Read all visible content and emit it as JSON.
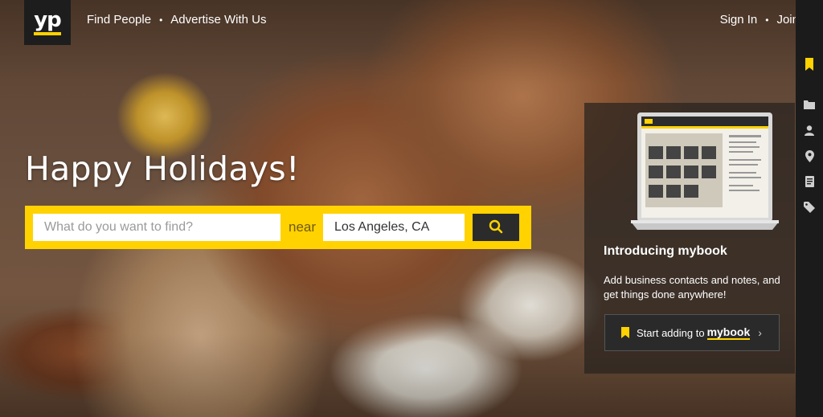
{
  "header": {
    "logo_text": "yp",
    "nav_left": [
      "Find People",
      "Advertise With Us"
    ],
    "nav_right": [
      "Sign In",
      "Join"
    ]
  },
  "hero": {
    "headline": "Happy Holidays!"
  },
  "search": {
    "what_placeholder": "What do you want to find?",
    "near_label": "near",
    "location_value": "Los Angeles, CA",
    "button_icon": "search-icon"
  },
  "mybook": {
    "title": "Introducing mybook",
    "description": "Add business contacts and notes, and get things done anywhere!",
    "button_prefix": "Start adding to",
    "button_brand": "mybook",
    "button_chevron": "›"
  },
  "sidebar": {
    "icons": [
      "bookmark-icon",
      "folder-icon",
      "user-icon",
      "location-pin-icon",
      "notes-icon",
      "tag-icon"
    ]
  },
  "colors": {
    "accent": "#ffd200",
    "dark": "#1b1b1b"
  }
}
